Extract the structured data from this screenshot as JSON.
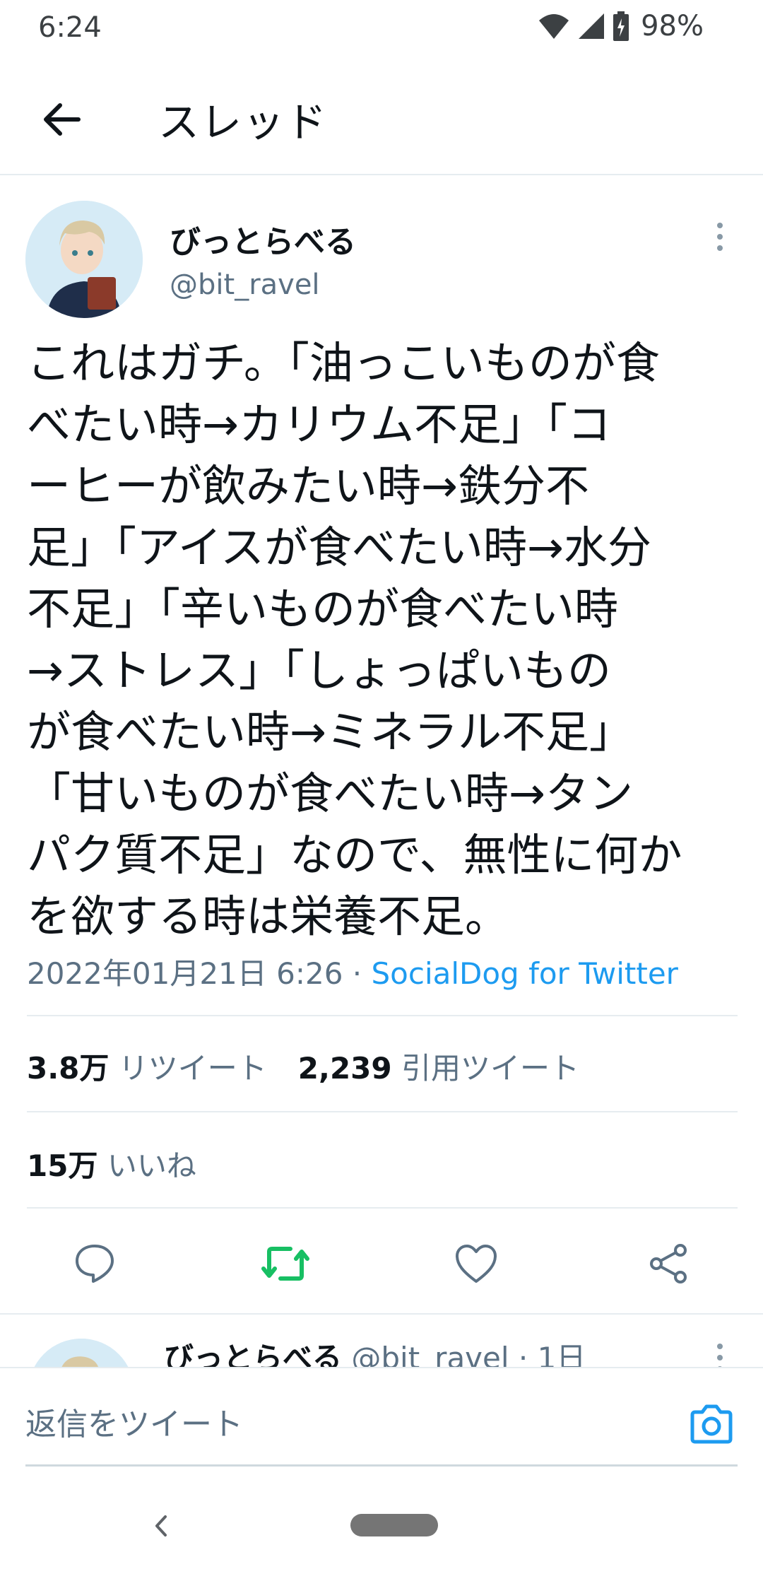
{
  "status_bar": {
    "time": "6:24",
    "battery": "98%"
  },
  "header": {
    "title": "スレッド"
  },
  "tweet": {
    "display_name": "びっとらべる",
    "handle": "@bit_ravel",
    "text": "これはガチ。「油っこいものが食\nべたい時→カリウム不足」「コ\nーヒーが飲みたい時→鉄分不\n足」「アイスが食べたい時→水分\n不足」「辛いものが食べたい時\n→ストレス」「しょっぱいもの\nが食べたい時→ミネラル不足」\n「甘いものが食べたい時→タン\nパク質不足」なので、無性に何か\nを欲する時は栄養不足。",
    "timestamp": "2022年01月21日 6:26 · ",
    "source": "SocialDog for Twitter",
    "retweets_count": "3.8万",
    "retweets_label": "リツイート",
    "quotes_count": "2,239",
    "quotes_label": "引用ツイート",
    "likes_count": "15万",
    "likes_label": "いいね"
  },
  "next_tweet": {
    "display_name": "びっとらべる",
    "handle_time": "@bit_ravel · 1日"
  },
  "composer": {
    "placeholder": "返信をツイート"
  },
  "colors": {
    "accent": "#1d9bf0",
    "retweet_green": "#17bf63",
    "secondary_text": "#5b7083"
  }
}
